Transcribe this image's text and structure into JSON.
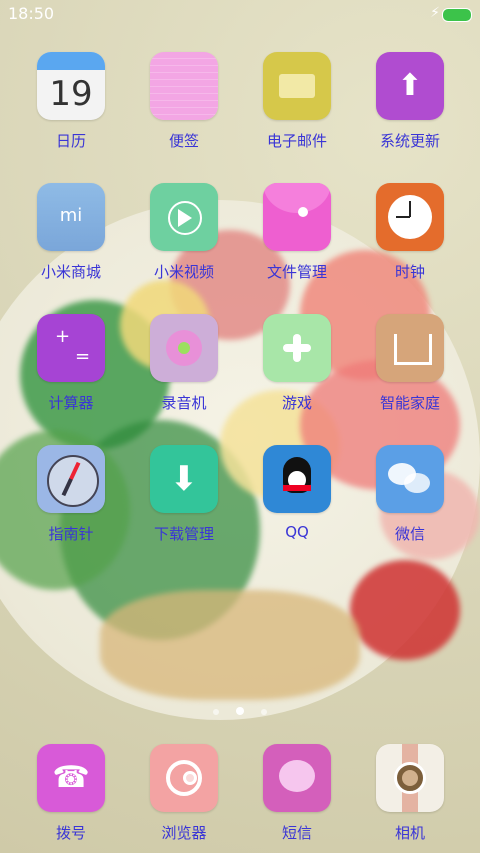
{
  "status": {
    "time": "18:50",
    "battery_color": "#3cc34a",
    "charging_icon": "lightning-icon"
  },
  "apps": [
    {
      "label": "日历",
      "icon": "calendar-icon",
      "day": "19"
    },
    {
      "label": "便签",
      "icon": "notes-icon"
    },
    {
      "label": "电子邮件",
      "icon": "email-icon"
    },
    {
      "label": "系统更新",
      "icon": "update-icon"
    },
    {
      "label": "小米商城",
      "icon": "mi-store-icon",
      "mi": "mi"
    },
    {
      "label": "小米视频",
      "icon": "video-icon"
    },
    {
      "label": "文件管理",
      "icon": "file-manager-icon"
    },
    {
      "label": "时钟",
      "icon": "clock-icon"
    },
    {
      "label": "计算器",
      "icon": "calculator-icon"
    },
    {
      "label": "录音机",
      "icon": "recorder-icon"
    },
    {
      "label": "游戏",
      "icon": "game-icon"
    },
    {
      "label": "智能家庭",
      "icon": "smart-home-icon"
    },
    {
      "label": "指南针",
      "icon": "compass-icon"
    },
    {
      "label": "下载管理",
      "icon": "download-icon"
    },
    {
      "label": "QQ",
      "icon": "qq-icon"
    },
    {
      "label": "微信",
      "icon": "wechat-icon"
    }
  ],
  "dock": [
    {
      "label": "拨号",
      "icon": "phone-icon"
    },
    {
      "label": "浏览器",
      "icon": "browser-icon"
    },
    {
      "label": "短信",
      "icon": "sms-icon"
    },
    {
      "label": "相机",
      "icon": "camera-icon"
    }
  ],
  "page_indicator": {
    "count": 3,
    "active_index": 1
  },
  "colors": {
    "label": "#3a35d6"
  }
}
